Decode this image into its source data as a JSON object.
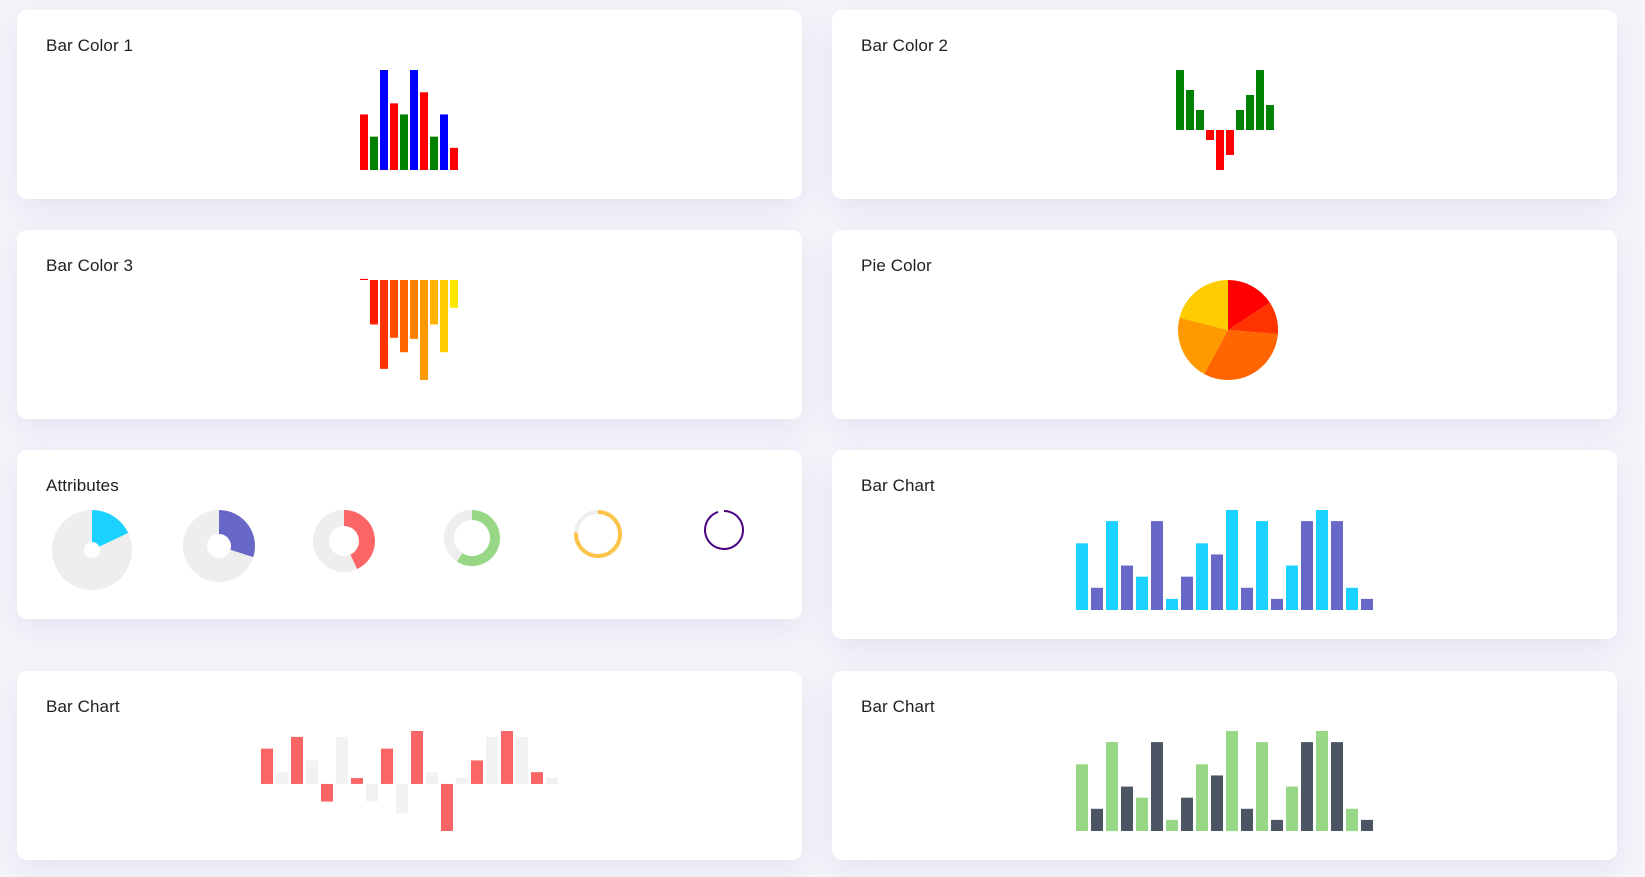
{
  "cards": {
    "bar_color_1": {
      "title": "Bar Color 1",
      "chart_data": {
        "type": "bar",
        "colors": [
          "#ff0000",
          "#008000",
          "#0000ff",
          "#ff0000",
          "#008000",
          "#0000ff",
          "#ff0000",
          "#008000",
          "#0000ff",
          "#ff0000"
        ],
        "values": [
          5,
          3,
          9,
          6,
          5,
          9,
          7,
          3,
          5,
          2
        ],
        "ylim": [
          0,
          9
        ]
      }
    },
    "bar_color_2": {
      "title": "Bar Color 2",
      "chart_data": {
        "type": "bar",
        "positive_color": "#008000",
        "negative_color": "#ff0000",
        "values": [
          6,
          4,
          2,
          -1,
          -4,
          -2.5,
          2,
          3.5,
          6,
          2.5
        ],
        "ylim": [
          -4,
          6
        ]
      }
    },
    "bar_color_3": {
      "title": "Bar Color 3",
      "chart_data": {
        "type": "bar",
        "colors": [
          "#ff0000",
          "#ff1a00",
          "#ff3300",
          "#ff4d00",
          "#ff6600",
          "#ff8000",
          "#ff9900",
          "#ffb300",
          "#ffcc00",
          "#ffe600"
        ],
        "values": [
          0.1,
          -4,
          -8,
          -5.2,
          -6.5,
          -5.3,
          -9,
          -4,
          -6.5,
          -2.5
        ],
        "ylim": [
          -9,
          0
        ]
      }
    },
    "pie_color": {
      "title": "Pie Color",
      "chart_data": {
        "type": "pie",
        "values": [
          1.5,
          1,
          3,
          2,
          2
        ],
        "colors": [
          "#ff0000",
          "#ff3300",
          "#ff6600",
          "#ff9900",
          "#ffcc00"
        ]
      }
    },
    "attributes": {
      "title": "Attributes",
      "donuts": [
        {
          "fraction": 0.18,
          "color": "#1ad1ff",
          "track": "#eeeeee"
        },
        {
          "fraction": 0.3,
          "color": "#6667c6",
          "track": "#eeeeee"
        },
        {
          "fraction": 0.43,
          "color": "#fb6565",
          "track": "#eeeeee"
        },
        {
          "fraction": 0.59,
          "color": "#98d785",
          "track": "#eeeeee"
        },
        {
          "fraction": 0.76,
          "color": "#fdc44a",
          "track": "#eeeeee"
        },
        {
          "fraction": 0.95,
          "color": "#4b0082",
          "track": "none"
        }
      ]
    },
    "bar_chart_a": {
      "title": "Bar Chart",
      "chart_data": {
        "type": "bar",
        "colors": [
          "#1ad1ff",
          "#6667c6"
        ],
        "values": [
          6,
          2,
          8,
          4,
          3,
          8,
          1,
          3,
          6,
          5,
          9,
          2,
          8,
          1,
          4,
          8,
          9,
          8,
          2,
          1
        ],
        "ylim": [
          0,
          9
        ]
      }
    },
    "bar_chart_b": {
      "title": "Bar Chart",
      "chart_data": {
        "type": "bar",
        "colors": [
          "#fb6565",
          "#f2f2f2"
        ],
        "values": [
          3,
          1,
          4,
          2,
          -1.5,
          4,
          0.5,
          -1.5,
          3,
          -2.5,
          4.5,
          1,
          -4,
          0.5,
          2,
          4,
          4.5,
          4,
          1,
          0.5
        ],
        "ylim": [
          -4,
          4.5
        ]
      }
    },
    "bar_chart_c": {
      "title": "Bar Chart",
      "chart_data": {
        "type": "bar",
        "colors": [
          "#98d785",
          "#4b5563"
        ],
        "values": [
          6,
          2,
          8,
          4,
          3,
          8,
          1,
          3,
          6,
          5,
          9,
          2,
          8,
          1,
          4,
          8,
          9,
          8,
          2,
          1
        ],
        "ylim": [
          0,
          9
        ]
      }
    }
  }
}
